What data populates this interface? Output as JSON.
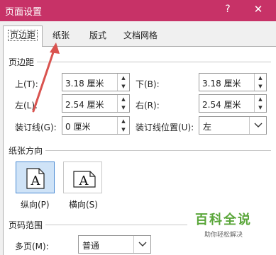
{
  "window": {
    "title": "页面设置",
    "help": "?",
    "close": "✕"
  },
  "tabs": [
    {
      "label": "页边距"
    },
    {
      "label": "纸张"
    },
    {
      "label": "版式"
    },
    {
      "label": "文档网格"
    }
  ],
  "margins": {
    "section_title": "页边距",
    "top": {
      "label": "上(T):",
      "value": "3.18 厘米"
    },
    "bottom": {
      "label": "下(B):",
      "value": "3.18 厘米"
    },
    "left": {
      "label": "左(L):",
      "value": "2.54 厘米"
    },
    "right": {
      "label": "右(R):",
      "value": "2.54 厘米"
    },
    "gutter": {
      "label": "装订线(G):",
      "value": "0 厘米"
    },
    "gutter_position": {
      "label": "装订线位置(U):",
      "value": "左"
    }
  },
  "orientation": {
    "section_title": "纸张方向",
    "portrait": {
      "label": "纵向(P)",
      "glyph": "A"
    },
    "landscape": {
      "label": "横向(S)",
      "glyph": "A"
    }
  },
  "pages": {
    "section_title": "页码范围",
    "multiple_label": "多页(M):",
    "multiple_value": "普通"
  },
  "watermark": {
    "title": "百科全说",
    "subtitle": "助你轻松解决"
  },
  "colors": {
    "titlebar": "#c73267",
    "annotation_arrow": "#d9534f",
    "selection": "#cfe3f7",
    "watermark": "#5aa63a"
  }
}
